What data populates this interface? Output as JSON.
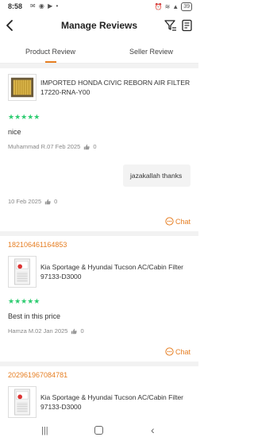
{
  "status_bar": {
    "time": "8:58",
    "battery": "39"
  },
  "header": {
    "title": "Manage Reviews"
  },
  "tabs": [
    {
      "label": "Product Review"
    },
    {
      "label": "Seller Review"
    }
  ],
  "reviews": [
    {
      "product_name": "IMPORTED HONDA CIVIC REBORN AIR FILTER 17220-RNA-Y00",
      "rating": 5,
      "stars": "★★★★★",
      "text": "nice",
      "author_date": "Muhammad R.07 Feb 2025",
      "likes": "0",
      "seller_reply": "jazakallah thanks",
      "reply_date": "10 Feb 2025",
      "reply_likes": "0",
      "chat_label": "Chat"
    },
    {
      "order_number": "182106461164853",
      "product_name": "Kia Sportage & Hyundai Tucson AC/Cabin Filter 97133-D3000",
      "rating": 5,
      "stars": "★★★★★",
      "text": "Best in this price",
      "author_date": "Hamza M.02 Jan 2025",
      "likes": "0",
      "chat_label": "Chat"
    },
    {
      "order_number": "202961967084781",
      "product_name": "Kia Sportage & Hyundai Tucson AC/Cabin Filter 97133-D3000"
    }
  ],
  "icons": {
    "back": "back-arrow-icon",
    "filter": "filter-icon",
    "receipt": "receipt-icon",
    "thumb": "thumbs-up-icon",
    "chat": "chat-bubble-icon"
  },
  "colors": {
    "accent": "#e67e22",
    "stars": "#2ecc71"
  }
}
